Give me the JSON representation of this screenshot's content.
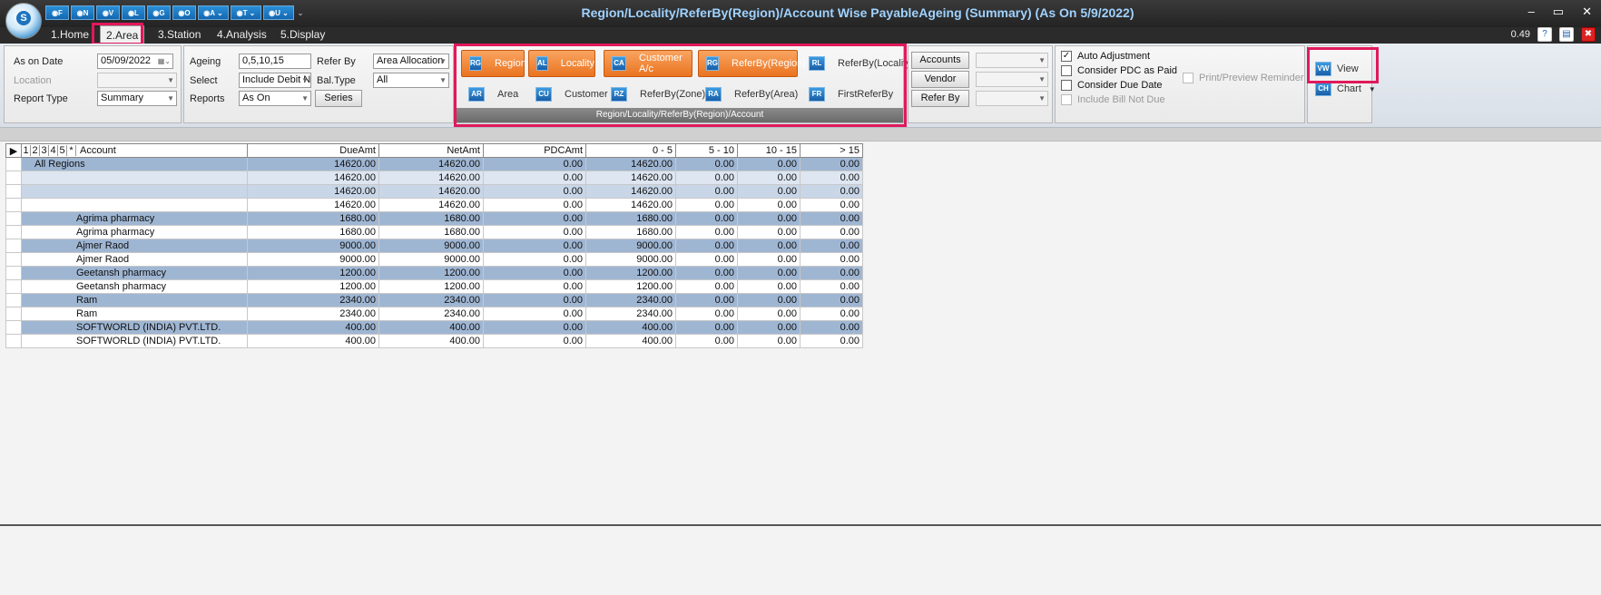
{
  "window": {
    "title": "Region/Locality/ReferBy(Region)/Account Wise PayableAgeing (Summary) (As On 5/9/2022)",
    "logo_letter": "S",
    "controls": [
      "‒",
      "▭",
      "✕"
    ]
  },
  "quick_access": [
    "◉F",
    "◉N",
    "◉V",
    "◉L",
    "◉G",
    "◉O",
    "◉A ⌄",
    "◉T ⌄",
    "◉U ⌄",
    "⌄"
  ],
  "tabs": [
    {
      "label": "1.Home"
    },
    {
      "label": "2.Area"
    },
    {
      "label": "3.Station"
    },
    {
      "label": "4.Analysis"
    },
    {
      "label": "5.Display"
    }
  ],
  "header_right": {
    "value": "0.49",
    "help": "?",
    "doc": "▤",
    "close": "✖"
  },
  "filters": {
    "as_on_date_label": "As on Date",
    "as_on_date": "05/09/2022",
    "location_label": "Location",
    "location": "",
    "report_type_label": "Report Type",
    "report_type": "Summary",
    "ageing_label": "Ageing",
    "ageing": "0,5,10,15",
    "select_label": "Select",
    "select": "Include Debit N",
    "reports_label": "Reports",
    "reports": "As On",
    "series_button": "Series",
    "refer_by_label": "Refer By",
    "refer_by": "Area Allocation",
    "bal_type_label": "Bal.Type",
    "bal_type": "All"
  },
  "grouping": {
    "footer": "Region/Locality/ReferBy(Region)/Account",
    "row1": [
      {
        "icon": "RG",
        "label": "Region"
      },
      {
        "icon": "AL",
        "label": "Locality"
      },
      {
        "icon": "CA",
        "label": "Customer A/c"
      },
      {
        "icon": "RG",
        "label": "ReferBy(Region)"
      },
      {
        "icon": "RL",
        "label": "ReferBy(Locality)"
      }
    ],
    "row2": [
      {
        "icon": "AR",
        "label": "Area"
      },
      {
        "icon": "CU",
        "label": "Customer"
      },
      {
        "icon": "RZ",
        "label": "ReferBy(Zone)"
      },
      {
        "icon": "RA",
        "label": "ReferBy(Area)"
      },
      {
        "icon": "FR",
        "label": "FirstReferBy"
      }
    ]
  },
  "side_buttons": {
    "accounts": "Accounts",
    "vendor": "Vendor",
    "refer_by": "Refer By"
  },
  "options": {
    "auto_adjustment": "Auto Adjustment",
    "consider_pdc": "Consider PDC as Paid",
    "consider_due": "Consider Due Date",
    "include_bill": "Include Bill Not Due",
    "print_preview": "Print/Preview Reminder",
    "check": "✓"
  },
  "actions": {
    "view": "View",
    "chart": "Chart",
    "view_icon": "VW",
    "chart_icon": "CH"
  },
  "grid": {
    "marker": "▶",
    "levels": [
      "1",
      "2",
      "3",
      "4",
      "5",
      "*"
    ],
    "columns": [
      "Account",
      "DueAmt",
      "NetAmt",
      "PDCAmt",
      "0 - 5",
      "5 - 10",
      "10 - 15",
      "> 15"
    ],
    "rows": [
      {
        "account": "All Regions",
        "vals": [
          "14620.00",
          "14620.00",
          "0.00",
          "14620.00",
          "0.00",
          "0.00",
          "0.00"
        ]
      },
      {
        "account": "",
        "vals": [
          "14620.00",
          "14620.00",
          "0.00",
          "14620.00",
          "0.00",
          "0.00",
          "0.00"
        ]
      },
      {
        "account": "",
        "vals": [
          "14620.00",
          "14620.00",
          "0.00",
          "14620.00",
          "0.00",
          "0.00",
          "0.00"
        ]
      },
      {
        "account": "",
        "vals": [
          "14620.00",
          "14620.00",
          "0.00",
          "14620.00",
          "0.00",
          "0.00",
          "0.00"
        ]
      },
      {
        "account": "Agrima pharmacy",
        "vals": [
          "1680.00",
          "1680.00",
          "0.00",
          "1680.00",
          "0.00",
          "0.00",
          "0.00"
        ]
      },
      {
        "account": "Agrima pharmacy",
        "vals": [
          "1680.00",
          "1680.00",
          "0.00",
          "1680.00",
          "0.00",
          "0.00",
          "0.00"
        ]
      },
      {
        "account": "Ajmer Raod",
        "vals": [
          "9000.00",
          "9000.00",
          "0.00",
          "9000.00",
          "0.00",
          "0.00",
          "0.00"
        ]
      },
      {
        "account": "Ajmer Raod",
        "vals": [
          "9000.00",
          "9000.00",
          "0.00",
          "9000.00",
          "0.00",
          "0.00",
          "0.00"
        ]
      },
      {
        "account": "Geetansh pharmacy",
        "vals": [
          "1200.00",
          "1200.00",
          "0.00",
          "1200.00",
          "0.00",
          "0.00",
          "0.00"
        ]
      },
      {
        "account": "Geetansh pharmacy",
        "vals": [
          "1200.00",
          "1200.00",
          "0.00",
          "1200.00",
          "0.00",
          "0.00",
          "0.00"
        ]
      },
      {
        "account": "Ram",
        "vals": [
          "2340.00",
          "2340.00",
          "0.00",
          "2340.00",
          "0.00",
          "0.00",
          "0.00"
        ]
      },
      {
        "account": "Ram",
        "vals": [
          "2340.00",
          "2340.00",
          "0.00",
          "2340.00",
          "0.00",
          "0.00",
          "0.00"
        ]
      },
      {
        "account": "SOFTWORLD (INDIA) PVT.LTD.",
        "vals": [
          "400.00",
          "400.00",
          "0.00",
          "400.00",
          "0.00",
          "0.00",
          "0.00"
        ]
      },
      {
        "account": "SOFTWORLD (INDIA) PVT.LTD.",
        "vals": [
          "400.00",
          "400.00",
          "0.00",
          "400.00",
          "0.00",
          "0.00",
          "0.00"
        ]
      }
    ]
  }
}
